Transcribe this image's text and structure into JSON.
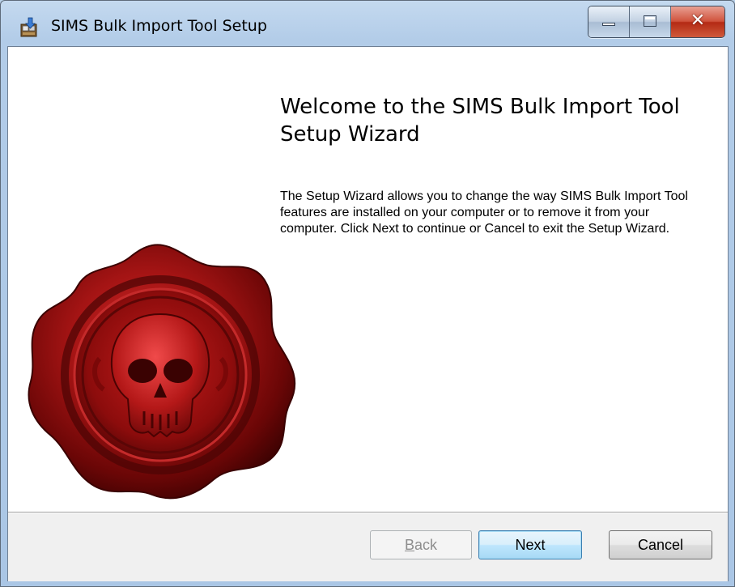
{
  "window": {
    "title": "SIMS Bulk Import Tool Setup",
    "caption_buttons": [
      "minimize",
      "maximize",
      "close"
    ]
  },
  "wizard": {
    "heading": "Welcome to the SIMS Bulk Import Tool Setup Wizard",
    "description": "The Setup Wizard allows you to change the way SIMS Bulk Import Tool features are installed on your computer or to remove it from your computer. Click Next to continue or Cancel to exit the Setup Wizard.",
    "graphic": "red-wax-skull-seal"
  },
  "buttons": {
    "back": {
      "label": "Back",
      "accel": "B",
      "rest": "ack",
      "enabled": false
    },
    "next": {
      "label": "Next",
      "enabled": true,
      "default": true
    },
    "cancel": {
      "label": "Cancel",
      "enabled": true
    }
  },
  "colors": {
    "title_bar": "#b9d1ea",
    "close_button": "#c7432a",
    "seal_red": "#9e1010",
    "footer": "#f0f0f0"
  }
}
